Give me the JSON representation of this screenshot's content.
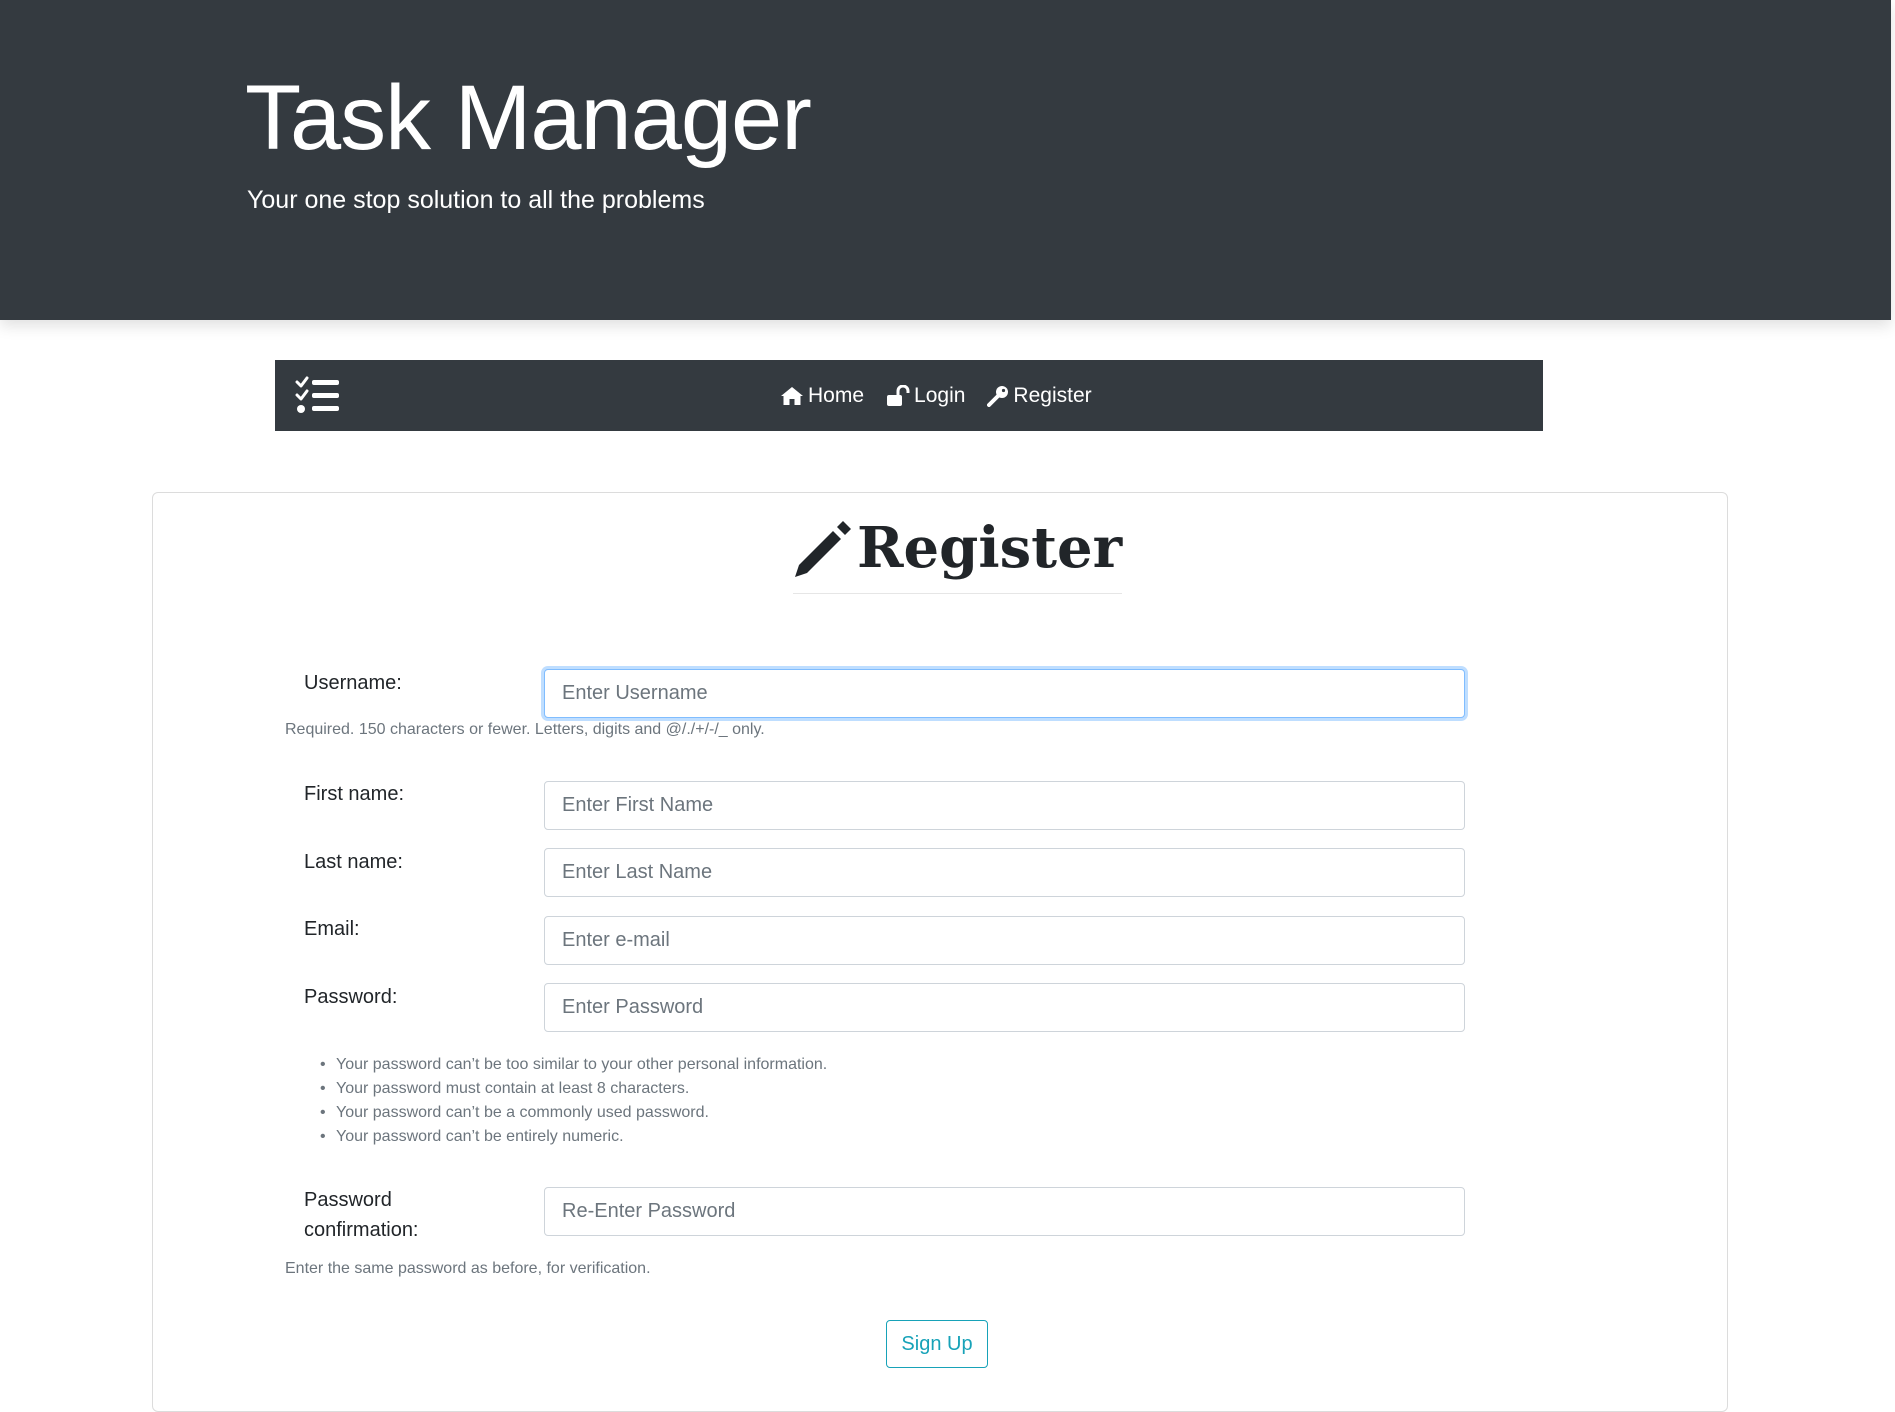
{
  "header": {
    "title": "Task Manager",
    "subtitle": "Your one stop solution to all the problems"
  },
  "navbar": {
    "brand_icon": "tasks-list-icon",
    "links": [
      {
        "label": "Home",
        "icon": "home-icon"
      },
      {
        "label": "Login",
        "icon": "unlock-icon"
      },
      {
        "label": "Register",
        "icon": "key-icon"
      }
    ]
  },
  "form": {
    "heading": "Register",
    "heading_icon": "pencil-icon",
    "username": {
      "label": "Username:",
      "placeholder": "Enter Username",
      "help": "Required. 150 characters or fewer. Letters, digits and @/./+/-/_ only."
    },
    "first_name": {
      "label": "First name:",
      "placeholder": "Enter First Name"
    },
    "last_name": {
      "label": "Last name:",
      "placeholder": "Enter Last Name"
    },
    "email": {
      "label": "Email:",
      "placeholder": "Enter e-mail"
    },
    "password": {
      "label": "Password:",
      "placeholder": "Enter Password",
      "rules": [
        "Your password can’t be too similar to your other personal information.",
        "Your password must contain at least 8 characters.",
        "Your password can’t be a commonly used password.",
        "Your password can’t be entirely numeric."
      ]
    },
    "password_confirm": {
      "label_line1": "Password",
      "label_line2": "confirmation:",
      "placeholder": "Re-Enter Password",
      "help": "Enter the same password as before, for verification."
    },
    "submit_label": "Sign Up"
  },
  "colors": {
    "dark": "#343a40",
    "accent": "#17a2b8",
    "focus": "#80bdff"
  }
}
